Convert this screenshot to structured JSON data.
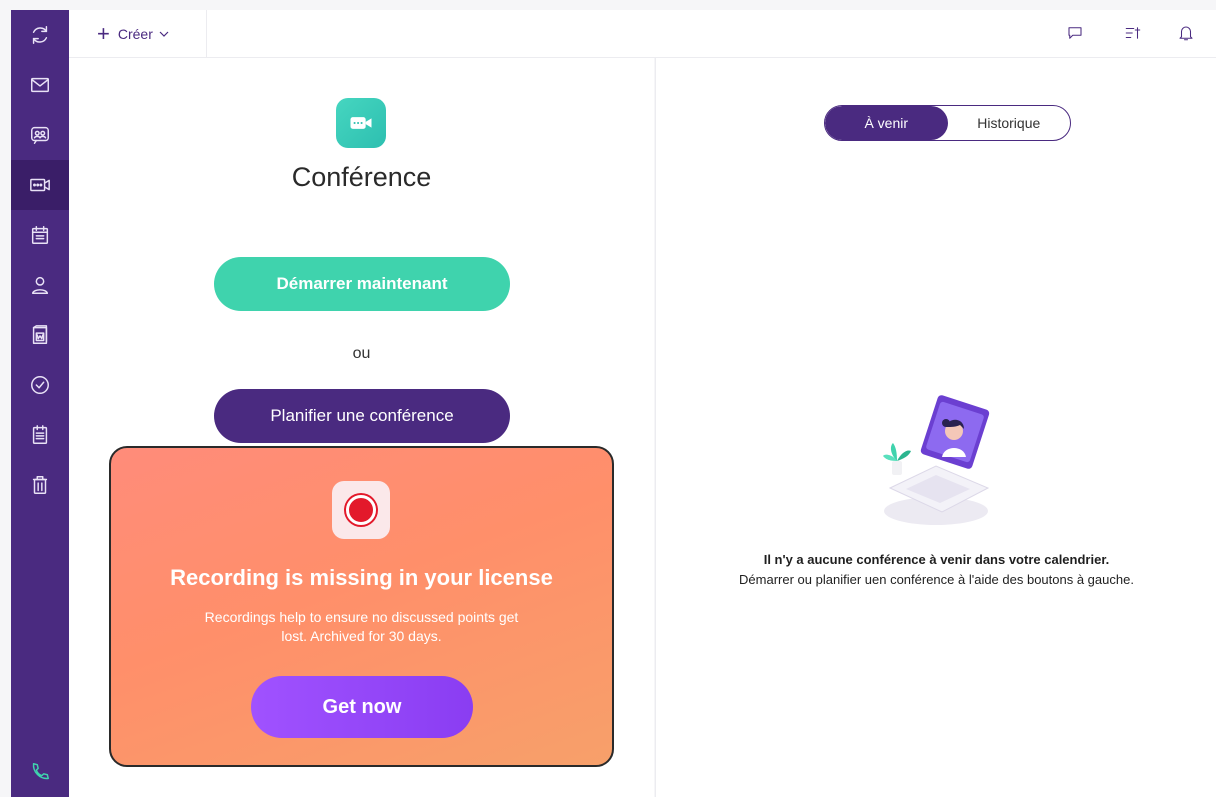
{
  "topbar": {
    "create_label": "Créer",
    "icons": [
      "chat-icon",
      "sort-icon",
      "bell-icon"
    ]
  },
  "sidebar": {
    "items": [
      {
        "name": "sync-icon"
      },
      {
        "name": "mail-icon"
      },
      {
        "name": "contacts-chat-icon"
      },
      {
        "name": "conference-icon",
        "active": true
      },
      {
        "name": "calendar-icon"
      },
      {
        "name": "user-icon"
      },
      {
        "name": "word-documents-icon"
      },
      {
        "name": "tasks-icon"
      },
      {
        "name": "notes-icon"
      },
      {
        "name": "trash-icon"
      },
      {
        "name": "phone-icon"
      }
    ]
  },
  "left": {
    "title": "Conférence",
    "start_label": "Démarrer maintenant",
    "or_label": "ou",
    "plan_label": "Planifier une conférence"
  },
  "promo": {
    "title": "Recording is missing in your license",
    "description": "Recordings help to ensure no discussed points get lost. Archived for 30 days.",
    "button_label": "Get now"
  },
  "right": {
    "tabs": [
      {
        "label": "À venir",
        "active": true
      },
      {
        "label": "Historique",
        "active": false
      }
    ],
    "empty_title": "Il n'y a aucune conférence à venir dans votre calendrier.",
    "empty_subtitle": "Démarrer ou planifier uen conférence à l'aide des boutons à gauche."
  },
  "colors": {
    "brand": "#4a2a80",
    "accent_green": "#3fd3ad",
    "promo_gradient": "#ff8c7a",
    "get_button": "#9a4cff"
  }
}
